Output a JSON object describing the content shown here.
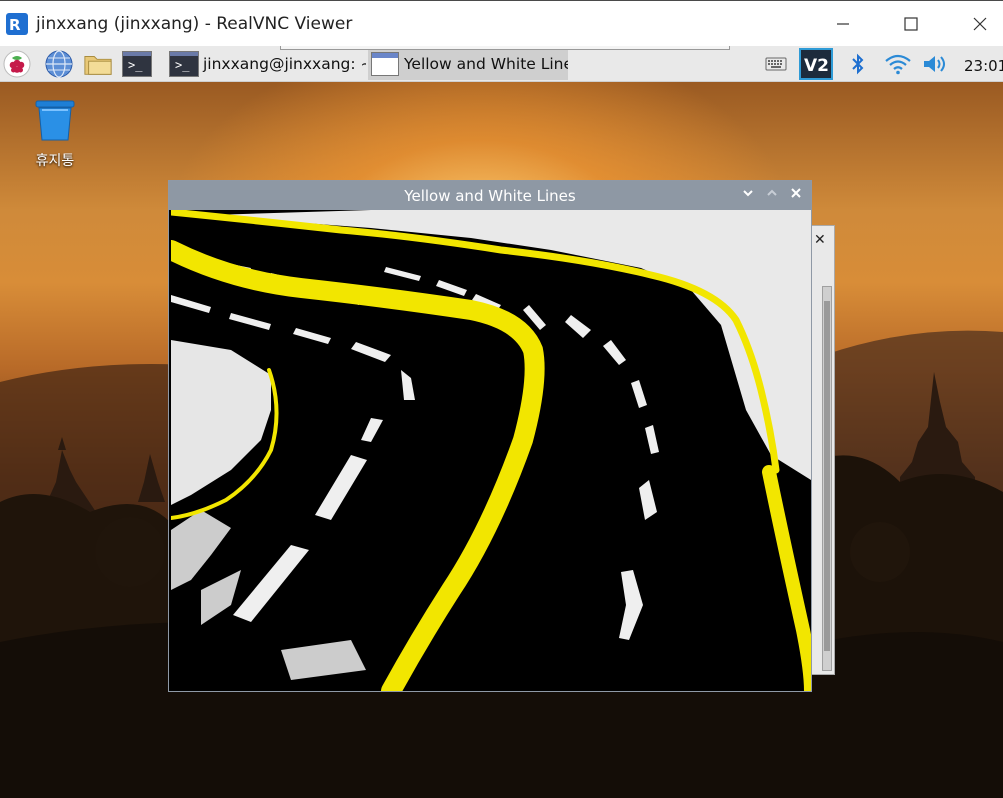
{
  "vnc_window": {
    "title": "jinxxang (jinxxang) - RealVNC Viewer",
    "logo_icon": "realvnc-logo-icon"
  },
  "taskbar": {
    "tasks": [
      {
        "label": "jinxxang@jinxxang: ~...",
        "icon": "terminal-icon",
        "active": false
      },
      {
        "label": "Yellow and White Lines",
        "icon": "window-icon",
        "active": true
      }
    ],
    "launchers": [
      "raspberry-menu-icon",
      "web-browser-icon",
      "file-manager-icon",
      "terminal-icon"
    ],
    "tray": [
      "keyboard-icon",
      "vnc-server-icon",
      "bluetooth-icon",
      "wifi-icon",
      "volume-icon"
    ],
    "clock": "23:01"
  },
  "desktop": {
    "trash_label": "휴지통"
  },
  "app_window": {
    "title": "Yellow and White Lines"
  },
  "colors": {
    "lane_yellow": "#f2e600",
    "lane_white": "#f2f2f2",
    "titlebar": "#8e98a4",
    "taskbar": "#e9e9e9"
  }
}
